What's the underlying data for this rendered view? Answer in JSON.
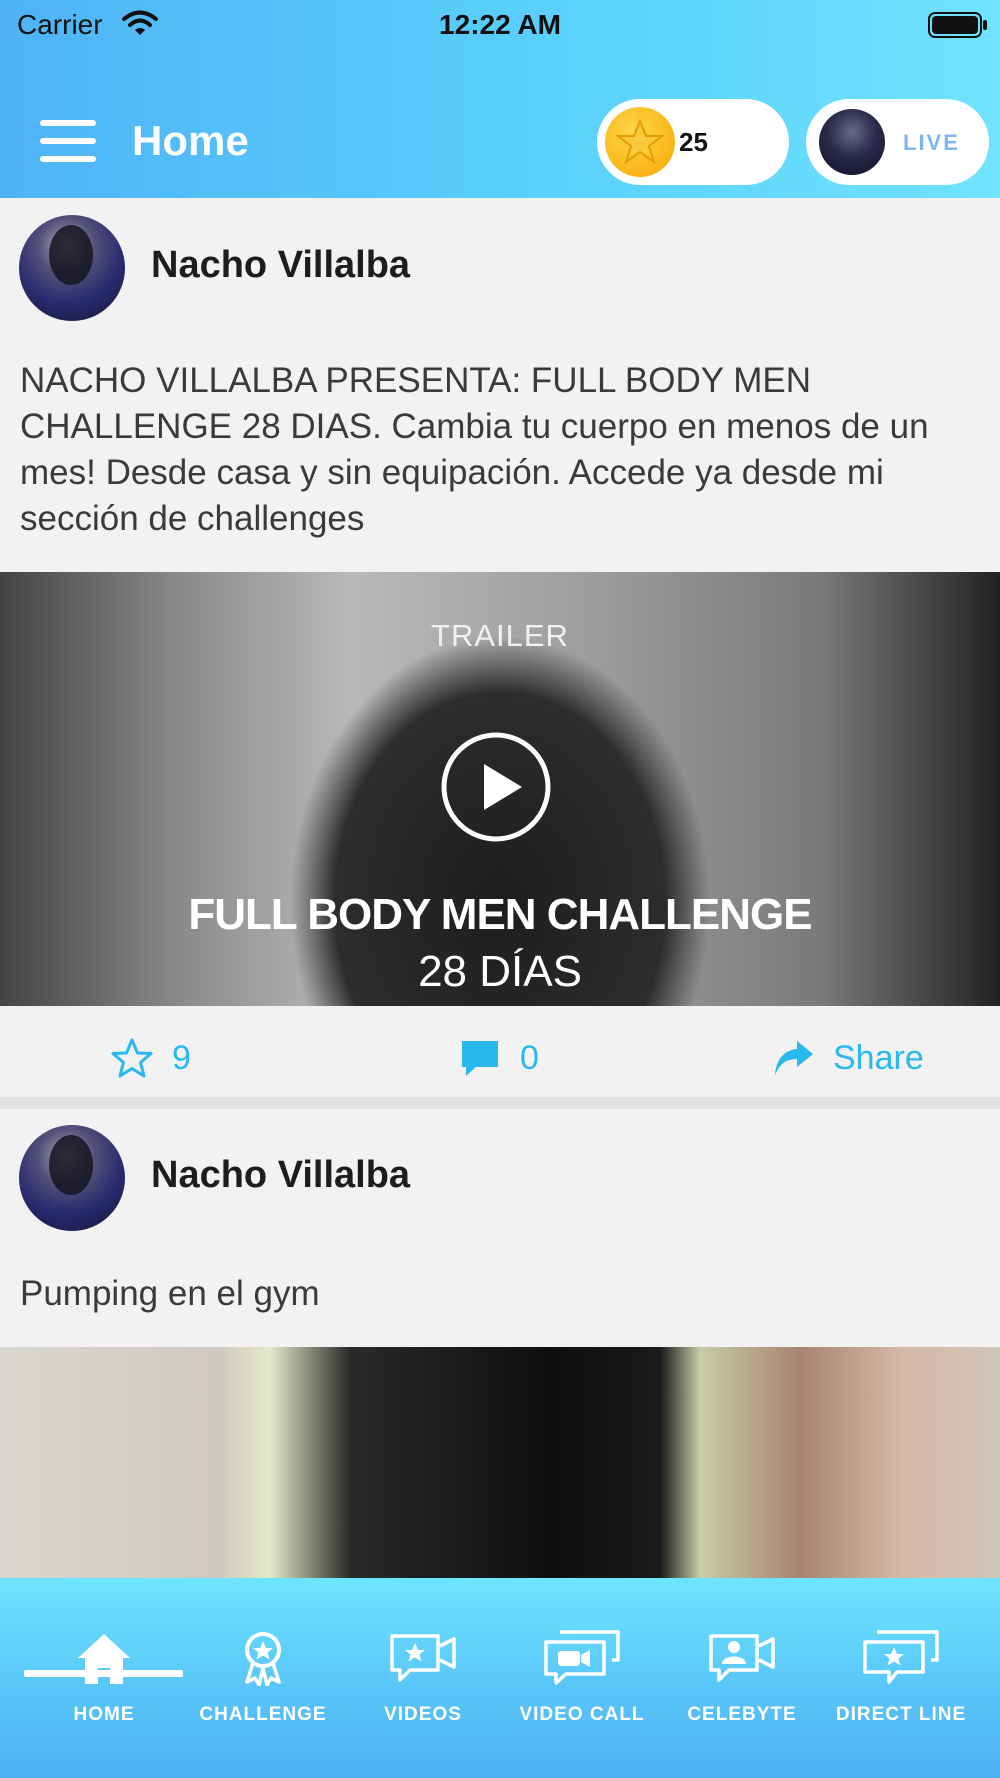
{
  "status_bar": {
    "carrier": "Carrier",
    "time": "12:22 AM"
  },
  "header": {
    "title": "Home",
    "coins": "25",
    "live_label": "LIVE"
  },
  "posts": [
    {
      "author": "Nacho Villalba",
      "text": "NACHO VILLALBA PRESENTA: FULL BODY MEN CHALLENGE 28 DIAS. Cambia tu cuerpo en menos de un mes! Desde casa y sin equipación. Accede ya desde mi sección de challenges",
      "media": {
        "overline": "TRAILER",
        "title": "FULL BODY MEN CHALLENGE",
        "subtitle": "28 DÍAS"
      },
      "likes": "9",
      "comments": "0",
      "share_label": "Share"
    },
    {
      "author": "Nacho Villalba",
      "text": "Pumping en el gym"
    }
  ],
  "tabs": [
    {
      "label": "HOME",
      "icon": "home-icon",
      "active": true
    },
    {
      "label": "CHALLENGE",
      "icon": "award-icon"
    },
    {
      "label": "VIDEOS",
      "icon": "video-star-icon"
    },
    {
      "label": "VIDEO CALL",
      "icon": "video-call-icon"
    },
    {
      "label": "CELEBYTE",
      "icon": "celebyte-icon"
    },
    {
      "label": "DIRECT LINE",
      "icon": "direct-line-icon"
    }
  ],
  "colors": {
    "accent": "#2ab8ef",
    "header_start": "#4fb3f6",
    "header_end": "#6fe3ff",
    "coin": "#f6b400"
  }
}
